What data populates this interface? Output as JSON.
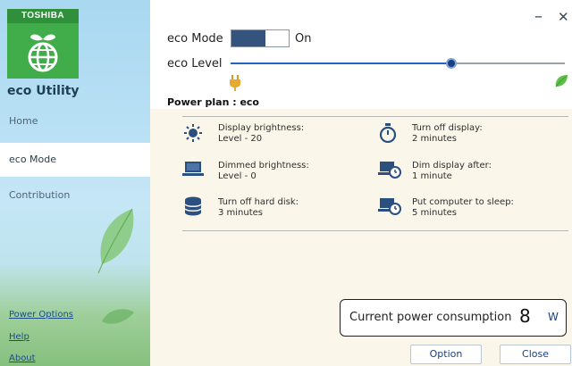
{
  "sidebar": {
    "brand": "TOSHIBA",
    "app_title": "eco Utility",
    "nav": [
      {
        "label": "Home"
      },
      {
        "label": "eco Mode"
      },
      {
        "label": "Contribution"
      }
    ],
    "links": [
      {
        "label": "Power Options"
      },
      {
        "label": "Help"
      },
      {
        "label": "About"
      }
    ]
  },
  "window": {
    "minimize": "–",
    "close": "✕"
  },
  "eco_mode": {
    "label": "eco Mode",
    "state": "On",
    "on": true
  },
  "eco_level": {
    "label": "eco Level",
    "value_fraction": 0.66
  },
  "power_plan": {
    "title": "Power plan : eco",
    "settings": [
      {
        "icon": "brightness-icon",
        "title": "Display brightness:",
        "value": "Level - 20"
      },
      {
        "icon": "timer-icon",
        "title": "Turn off display:",
        "value": "2 minutes"
      },
      {
        "icon": "laptop-icon",
        "title": "Dimmed brightness:",
        "value": "Level - 0"
      },
      {
        "icon": "display-timer-icon",
        "title": "Dim display after:",
        "value": "1 minute"
      },
      {
        "icon": "hard-disk-icon",
        "title": "Turn off hard disk:",
        "value": "3 minutes"
      },
      {
        "icon": "sleep-timer-icon",
        "title": "Put computer to sleep:",
        "value": "5 minutes"
      }
    ]
  },
  "consumption": {
    "label": "Current power consumption",
    "value": "8",
    "unit": "W"
  },
  "buttons": {
    "option": "Option",
    "close": "Close"
  },
  "colors": {
    "accent": "#1f66c2",
    "toggle_fill": "#34547e",
    "brand_green": "#41ad4a"
  }
}
